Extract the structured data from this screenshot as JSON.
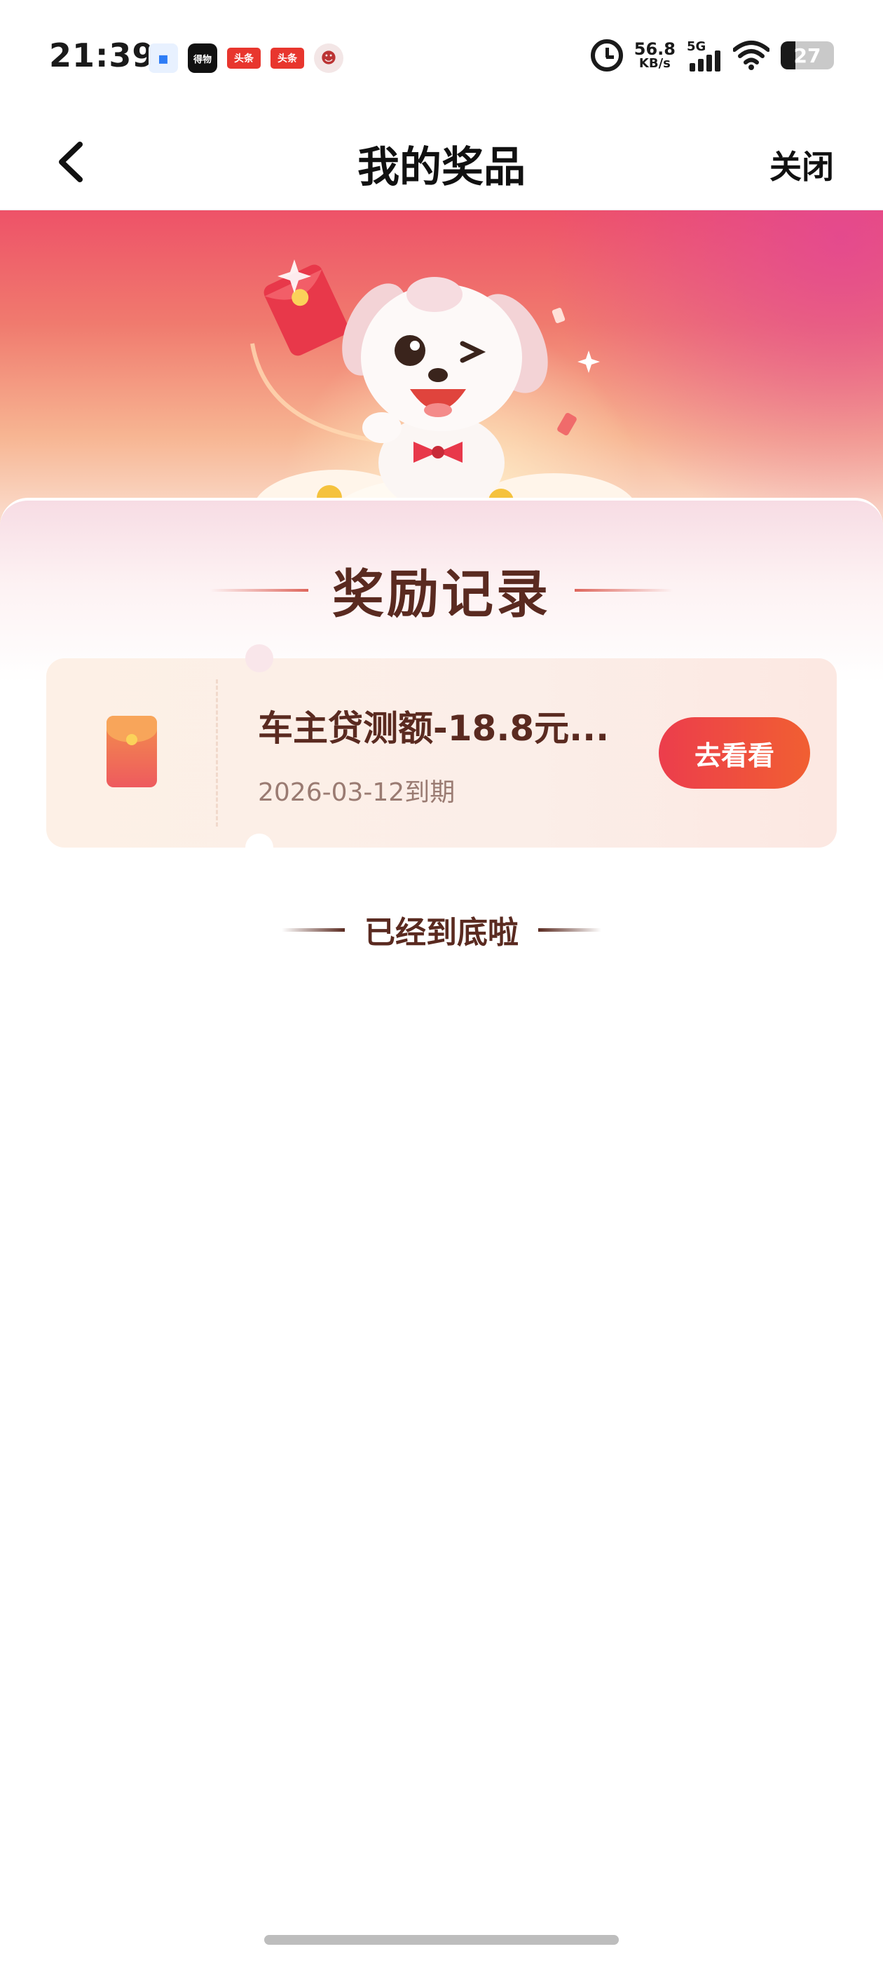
{
  "status_bar": {
    "time": "21:39",
    "notifications": [
      {
        "icon": "message-bubble-icon",
        "label": ""
      },
      {
        "icon": "dewu-app-icon",
        "label": "得物"
      },
      {
        "icon": "toutiao-app-icon",
        "label": "头条"
      },
      {
        "icon": "toutiao-app-icon",
        "label": "头条"
      },
      {
        "icon": "avatar-icon",
        "label": ""
      }
    ],
    "net_speed_value": "56.8",
    "net_speed_unit": "KB/s",
    "network_type": "5G",
    "battery_level": "27"
  },
  "nav": {
    "title": "我的奖品",
    "close_label": "关闭"
  },
  "section": {
    "title": "奖励记录"
  },
  "rewards": [
    {
      "name": "车主贷测额-18.8元...",
      "expiry": "2026-03-12到期",
      "button_label": "去看看"
    }
  ],
  "footer": {
    "end_text": "已经到底啦"
  },
  "colors": {
    "accent_red": "#ec3d4c",
    "accent_orange": "#f15f32",
    "title_brown": "#5a2a20"
  }
}
